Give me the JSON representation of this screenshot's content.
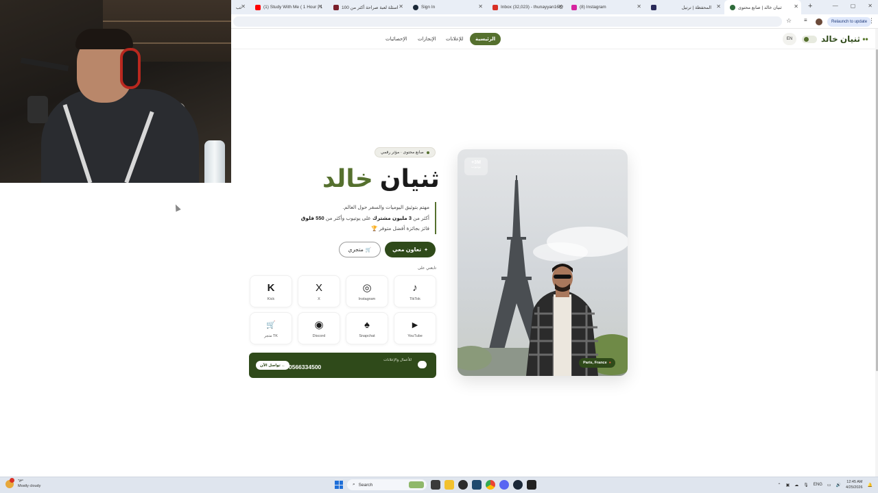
{
  "browser": {
    "tabs": [
      {
        "label": "ثنيان خالد | صانع محتوى",
        "favicon_color": "#ffffff",
        "active": true
      },
      {
        "label": "المحفظة | ترتيل",
        "favicon_color": "#2a2a5a",
        "active": false
      },
      {
        "label": "(8) Instagram",
        "favicon_color": "#d6249f",
        "active": false
      },
      {
        "label": "Inbox (32,023) - thunayyan16@",
        "favicon_color": "#d93025",
        "active": false
      },
      {
        "label": "Sign In",
        "favicon_color": "#1b2838",
        "active": false
      },
      {
        "label": "اسئلة لعبة صراحة أكثر من 100",
        "favicon_color": "#7a1f2b",
        "active": false
      },
      {
        "label": "(1) Study With Me ( 1 Hour | 1",
        "favicon_color": "#ff0000",
        "active": false
      },
      {
        "label": "ثب",
        "favicon_color": "#888888",
        "active": false
      }
    ],
    "relaunch_label": "Relaunch to update"
  },
  "nav": {
    "brand": "ثنيان خالد",
    "lang": "EN",
    "home": "الرئيسية",
    "ads": "للإعلانات",
    "achievements": "الإنجازات",
    "stats": "الإحصائيات"
  },
  "hero": {
    "tag": "صانع محتوى · مؤثر رقمي",
    "name_first": "ثنيان",
    "name_last": "خالد",
    "bio_line1": "مهتم بتوثيق اليوميات والسفر حول العالم.",
    "bio_line2_pre": "أكثر من ",
    "bio_line2_b1": "3 مليون مشترك",
    "bio_line2_mid": " على يوتيوب وأكثر من ",
    "bio_line2_b2": "550 فلوق",
    "bio_line3": "فائز بجائزة أفضل متوفر 🏆",
    "btn_collab": "تعاون معي",
    "btn_store": "متجري",
    "follow_label": "تابعني على"
  },
  "socials": [
    {
      "name": "tiktok",
      "label": "TikTok",
      "glyph": "♪"
    },
    {
      "name": "instagram",
      "label": "Instagram",
      "glyph": "◎"
    },
    {
      "name": "x",
      "label": "X",
      "glyph": "X"
    },
    {
      "name": "kick",
      "label": "Kick",
      "glyph": "K"
    },
    {
      "name": "youtube",
      "label": "YouTube",
      "glyph": "▶"
    },
    {
      "name": "snapchat",
      "label": "Snapchat",
      "glyph": "♠"
    },
    {
      "name": "discord",
      "label": "Discord",
      "glyph": "◉"
    },
    {
      "name": "store",
      "label": "متجر TK",
      "glyph": "🛒"
    }
  ],
  "contact": {
    "subtitle": "للأعمال والإعلانات",
    "phone": "0566334500",
    "cta": "تواصل الآن ←"
  },
  "photo": {
    "subs_count": "+3M",
    "subs_label": "يوتيوب",
    "location": "Paris, France"
  },
  "taskbar": {
    "weather_temp": "٦٣°",
    "weather_desc": "Mostly cloudy",
    "search": "Search",
    "lang": "ENG",
    "time": "12:45 AM",
    "date": "4/25/2026"
  },
  "colors": {
    "brand_green": "#2f4a1a",
    "accent_green": "#55702e"
  }
}
